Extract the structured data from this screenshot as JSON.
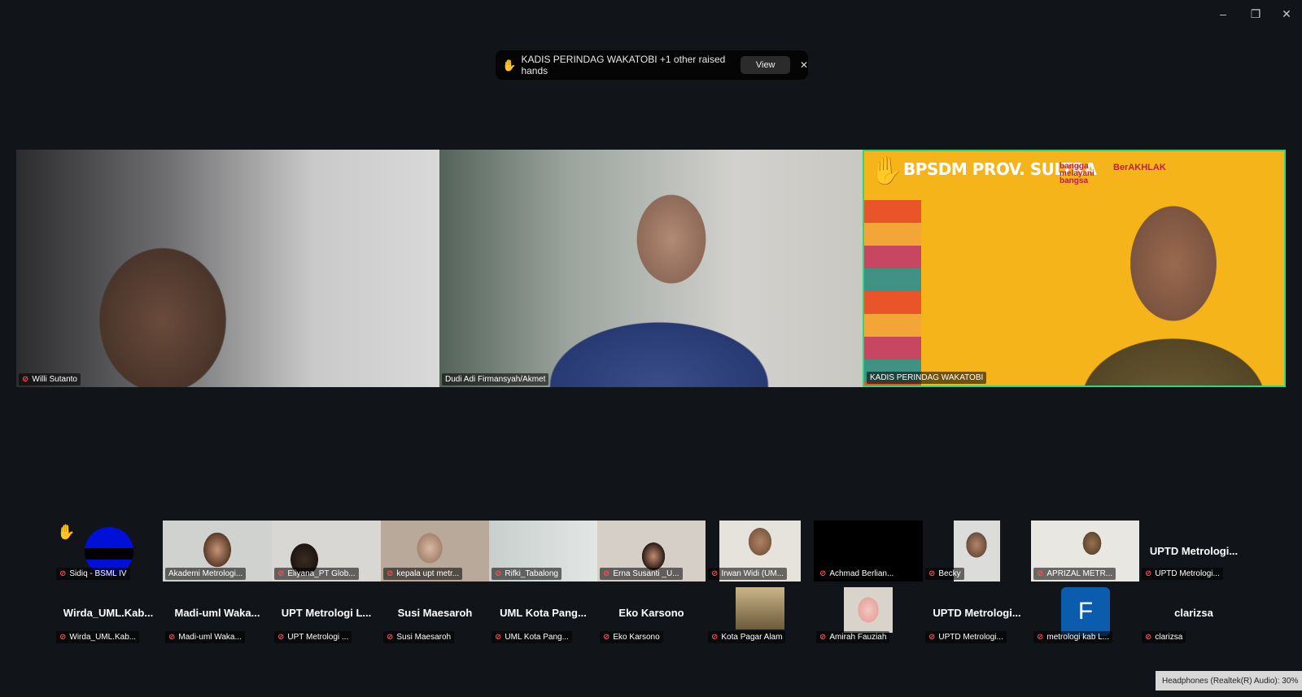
{
  "window": {
    "minimize_glyph": "–",
    "restore_glyph": "❐",
    "close_glyph": "✕"
  },
  "raised_hands_banner": {
    "text": "KADIS PERINDAG WAKATOBI +1 other raised hands",
    "view_label": "View",
    "close_glyph": "✕"
  },
  "main_tiles": [
    {
      "name": "Willi Sutanto"
    },
    {
      "name": "Dudi Adi Firmansyah/Akmet"
    },
    {
      "name": "KADIS PERINDAG WAKATOBI",
      "background_title": "BPSDM PROV. SULTRA",
      "logo_text_1": "bangga melayani bangsa",
      "logo_text_2": "BerAKHLAK"
    }
  ],
  "row1": [
    {
      "name": "Sidiq - BSML IV"
    },
    {
      "name": "Akademi Metrologi..."
    },
    {
      "name": "Eliyana_PT Glob..."
    },
    {
      "name": "kepala upt metr..."
    },
    {
      "name": "Rifki_Tabalong"
    },
    {
      "name": "Erna Susanti _U..."
    },
    {
      "name": "Irwan Widi (UM..."
    },
    {
      "name": "Achmad Berlian..."
    },
    {
      "name": "Becky"
    },
    {
      "name": "APRIZAL METR..."
    },
    {
      "name": "UPTD Metrologi...",
      "label": "UPTD  Metrologi..."
    }
  ],
  "row2": [
    {
      "name": "Wirda_UML.Kab...",
      "label": "Wirda_UML.Kab..."
    },
    {
      "name": "Madi-uml Waka...",
      "label": "Madi-uml  Waka..."
    },
    {
      "name": "UPT Metrologi ...",
      "label": "UPT  Metrologi  L..."
    },
    {
      "name": "Susi Maesaroh",
      "label": "Susi Maesaroh"
    },
    {
      "name": "UML Kota Pang...",
      "label": "UML  Kota  Pang..."
    },
    {
      "name": "Eko Karsono",
      "label": "Eko Karsono"
    },
    {
      "name": "Kota Pagar Alam"
    },
    {
      "name": "Amirah Fauziah"
    },
    {
      "name": "UPTD Metrologi...",
      "label": "UPTD  Metrologi..."
    },
    {
      "name": "metrologi kab L...",
      "avatar_letter": "F"
    },
    {
      "name": "clarizsa",
      "label": "clarizsa"
    }
  ],
  "status": {
    "headphones": "Headphones (Realtek(R) Audio): 30%"
  },
  "colors": {
    "active_speaker_border": "#2fd67b",
    "muted_mic": "#ff4d4d",
    "avatar_bg": "#0b5cad"
  }
}
